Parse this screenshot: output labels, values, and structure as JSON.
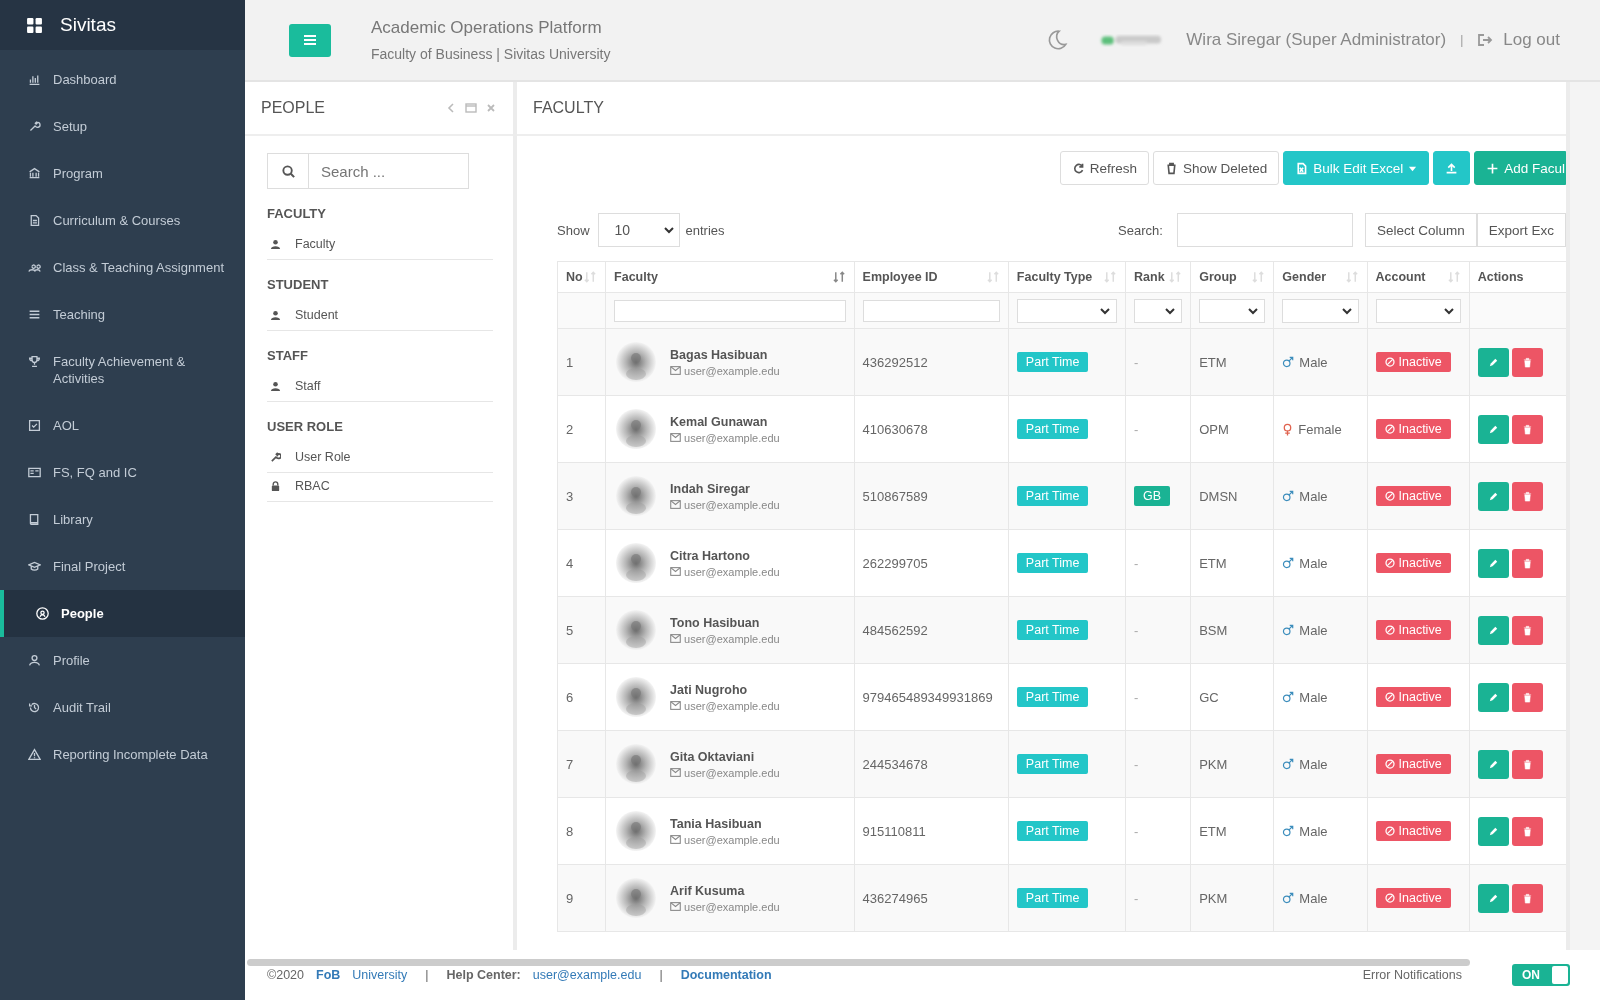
{
  "brand": "Sivitas",
  "sidebar": {
    "items": [
      {
        "label": "Dashboard",
        "selected": false
      },
      {
        "label": "Setup",
        "selected": false
      },
      {
        "label": "Program",
        "selected": false
      },
      {
        "label": "Curriculum & Courses",
        "selected": false
      },
      {
        "label": "Class & Teaching Assignment",
        "selected": false
      },
      {
        "label": "Teaching",
        "selected": false
      },
      {
        "label": "Faculty Achievement & Activities",
        "selected": false
      },
      {
        "label": "AOL",
        "selected": false
      },
      {
        "label": "FS, FQ and IC",
        "selected": false
      },
      {
        "label": "Library",
        "selected": false
      },
      {
        "label": "Final Project",
        "selected": false
      },
      {
        "label": "People",
        "selected": true
      },
      {
        "label": "Profile",
        "selected": false
      },
      {
        "label": "Audit Trail",
        "selected": false
      },
      {
        "label": "Reporting Incomplete Data",
        "selected": false
      }
    ]
  },
  "header": {
    "title": "Academic Operations Platform",
    "subtitle": "Faculty of Business | Sivitas University",
    "user": "Wira Siregar (Super Administrator)",
    "separator": "|",
    "logout": "Log out"
  },
  "people_panel": {
    "title": "PEOPLE",
    "search": {
      "placeholder": "Search ..."
    },
    "groups": [
      {
        "heading": "FACULTY",
        "items": [
          "Faculty"
        ]
      },
      {
        "heading": "STUDENT",
        "items": [
          "Student"
        ]
      },
      {
        "heading": "STAFF",
        "items": [
          "Staff"
        ]
      },
      {
        "heading": "USER ROLE",
        "items": [
          "User Role",
          "RBAC"
        ]
      }
    ]
  },
  "faculty_panel": {
    "title": "FACULTY",
    "toolbar": [
      {
        "label": "Refresh",
        "kind": "plain"
      },
      {
        "label": "Show Deleted",
        "kind": "plain"
      },
      {
        "label": "Bulk Edit Excel",
        "kind": "dropdown"
      },
      {
        "kind": "upload"
      },
      {
        "label": "Add Facul",
        "kind": "add"
      }
    ],
    "show_label": "Show",
    "entries_value": "10",
    "entries_label": "entries",
    "search_label": "Search:",
    "column_buttons": [
      "Select Column",
      "Export Exc"
    ],
    "table": {
      "columns": [
        {
          "label": "No",
          "sortable": true,
          "sorted": false,
          "kind": "plain"
        },
        {
          "label": "Faculty",
          "sortable": true,
          "sorted": true,
          "kind": "text"
        },
        {
          "label": "Employee ID",
          "sortable": true,
          "sorted": false,
          "kind": "text"
        },
        {
          "label": "Faculty Type",
          "sortable": true,
          "sorted": false,
          "kind": "select"
        },
        {
          "label": "Rank",
          "sortable": true,
          "sorted": false,
          "kind": "select"
        },
        {
          "label": "Group",
          "sortable": true,
          "sorted": false,
          "kind": "select"
        },
        {
          "label": "Gender",
          "sortable": true,
          "sorted": false,
          "kind": "select"
        },
        {
          "label": "Account",
          "sortable": true,
          "sorted": false,
          "kind": "select"
        },
        {
          "label": "Actions",
          "kind": "plain"
        }
      ],
      "rows": [
        {
          "no": "1",
          "name": "Bagas Hasibuan",
          "email": "user@example.edu",
          "employee_id": "436292512",
          "type": "Part Time",
          "rank": "-",
          "rank_badge": false,
          "group": "ETM",
          "gender": "Male",
          "kind": "male",
          "account": "Inactive"
        },
        {
          "no": "2",
          "name": "Kemal Gunawan",
          "email": "user@example.edu",
          "employee_id": "410630678",
          "type": "Part Time",
          "rank": "-",
          "rank_badge": false,
          "group": "OPM",
          "gender": "Female",
          "kind": "female",
          "account": "Inactive"
        },
        {
          "no": "3",
          "name": "Indah Siregar",
          "email": "user@example.edu",
          "employee_id": "510867589",
          "type": "Part Time",
          "rank": "GB",
          "rank_badge": true,
          "group": "DMSN",
          "gender": "Male",
          "kind": "male",
          "account": "Inactive"
        },
        {
          "no": "4",
          "name": "Citra Hartono",
          "email": "user@example.edu",
          "employee_id": "262299705",
          "type": "Part Time",
          "rank": "-",
          "rank_badge": false,
          "group": "ETM",
          "gender": "Male",
          "kind": "male",
          "account": "Inactive"
        },
        {
          "no": "5",
          "name": "Tono Hasibuan",
          "email": "user@example.edu",
          "employee_id": "484562592",
          "type": "Part Time",
          "rank": "-",
          "rank_badge": false,
          "group": "BSM",
          "gender": "Male",
          "kind": "male",
          "account": "Inactive"
        },
        {
          "no": "6",
          "name": "Jati Nugroho",
          "email": "user@example.edu",
          "employee_id": "979465489349931869",
          "type": "Part Time",
          "rank": "-",
          "rank_badge": false,
          "group": "GC",
          "gender": "Male",
          "kind": "male",
          "account": "Inactive"
        },
        {
          "no": "7",
          "name": "Gita Oktaviani",
          "email": "user@example.edu",
          "employee_id": "244534678",
          "type": "Part Time",
          "rank": "-",
          "rank_badge": false,
          "group": "PKM",
          "gender": "Male",
          "kind": "male",
          "account": "Inactive"
        },
        {
          "no": "8",
          "name": "Tania Hasibuan",
          "email": "user@example.edu",
          "employee_id": "915110811",
          "type": "Part Time",
          "rank": "-",
          "rank_badge": false,
          "group": "ETM",
          "gender": "Male",
          "kind": "male",
          "account": "Inactive"
        },
        {
          "no": "9",
          "name": "Arif Kusuma",
          "email": "user@example.edu",
          "employee_id": "436274965",
          "type": "Part Time",
          "rank": "-",
          "rank_badge": false,
          "group": "PKM",
          "gender": "Male",
          "kind": "male",
          "account": "Inactive"
        }
      ]
    }
  },
  "footer": {
    "copyright": "©2020",
    "org_link": "FoB",
    "university_link": "University",
    "separator": "|",
    "help_label": "Help Center:",
    "help_email": "user@example.edu",
    "docs_link": "Documentation",
    "error_label": "Error Notifications",
    "toggle": {
      "label": "ON",
      "on": true
    }
  }
}
